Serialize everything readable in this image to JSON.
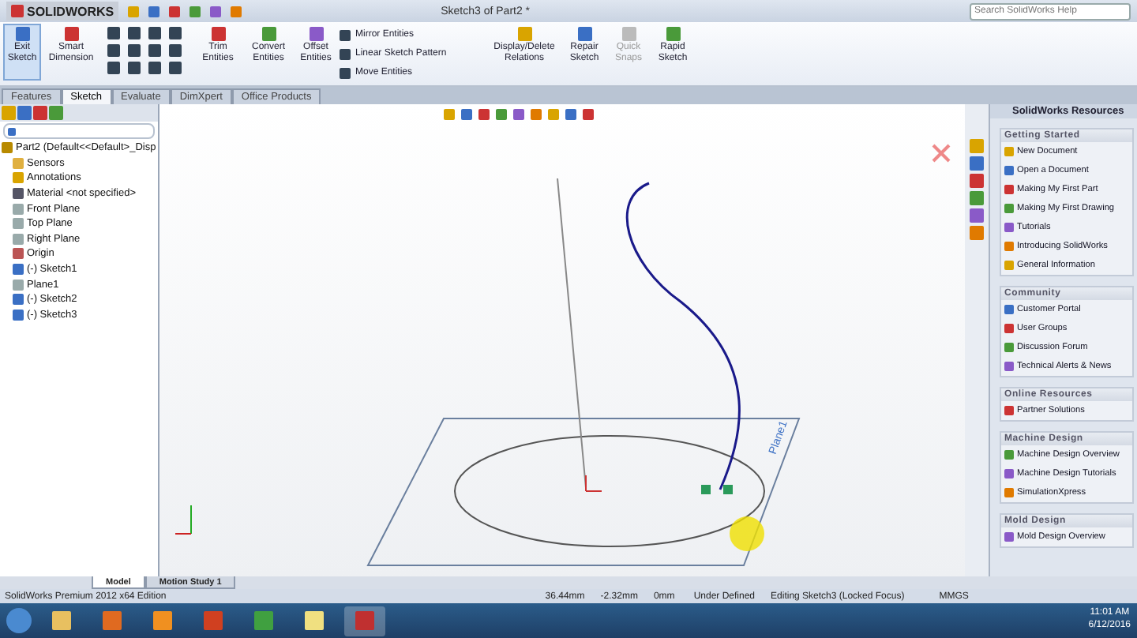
{
  "title_bar": {
    "app_name": "SOLIDWORKS",
    "document_title": "Sketch3 of Part2 *",
    "search": {
      "placeholder": "Search SolidWorks Help"
    }
  },
  "ribbon": {
    "large_buttons": [
      {
        "label": "Exit Sketch",
        "selected": true,
        "disabled": false
      },
      {
        "label": "Smart Dimension",
        "selected": false,
        "disabled": false
      },
      {
        "label": "Trim Entities",
        "selected": false,
        "disabled": false
      },
      {
        "label": "Convert Entities",
        "selected": false,
        "disabled": false
      },
      {
        "label": "Offset Entities",
        "selected": false,
        "disabled": false
      }
    ],
    "small_buttons": [
      "Mirror Entities",
      "Linear Sketch Pattern",
      "Move Entities"
    ],
    "right_buttons": [
      {
        "label": "Display/Delete Relations",
        "disabled": false
      },
      {
        "label": "Repair Sketch",
        "disabled": false
      },
      {
        "label": "Quick Snaps",
        "disabled": true
      },
      {
        "label": "Rapid Sketch",
        "disabled": false
      }
    ]
  },
  "command_tabs": [
    {
      "label": "Features",
      "selected": false
    },
    {
      "label": "Sketch",
      "selected": true
    },
    {
      "label": "Evaluate",
      "selected": false
    },
    {
      "label": "DimXpert",
      "selected": false
    },
    {
      "label": "Office Products",
      "selected": false
    }
  ],
  "feature_tree": {
    "root": "Part2  (Default<<Default>_Disp",
    "items": [
      {
        "label": "Sensors",
        "kind": "folder"
      },
      {
        "label": "Annotations",
        "kind": "annotation"
      },
      {
        "label": "Material <not specified>",
        "kind": "material"
      },
      {
        "label": "Front Plane",
        "kind": "plane"
      },
      {
        "label": "Top Plane",
        "kind": "plane"
      },
      {
        "label": "Right Plane",
        "kind": "plane"
      },
      {
        "label": "Origin",
        "kind": "origin"
      },
      {
        "label": "(-) Sketch1",
        "kind": "sketch"
      },
      {
        "label": "Plane1",
        "kind": "plane"
      },
      {
        "label": "(-) Sketch2",
        "kind": "sketch"
      },
      {
        "label": "(-) Sketch3",
        "kind": "sketch"
      }
    ]
  },
  "canvas": {
    "plane_label": "Plane1"
  },
  "task_pane": {
    "title": "SolidWorks Resources",
    "sections": [
      {
        "title": "Getting Started",
        "items": [
          "New Document",
          "Open a Document",
          "Making My First Part",
          "Making My First Drawing",
          "Tutorials",
          "Introducing SolidWorks",
          "General Information"
        ]
      },
      {
        "title": "Community",
        "items": [
          "Customer Portal",
          "User Groups",
          "Discussion Forum",
          "Technical Alerts & News"
        ]
      },
      {
        "title": "Online Resources",
        "items": [
          "Partner Solutions"
        ]
      },
      {
        "title": "Machine Design",
        "items": [
          "Machine Design Overview",
          "Machine Design Tutorials",
          "SimulationXpress"
        ]
      },
      {
        "title": "Mold Design",
        "items": [
          "Mold Design Overview"
        ]
      }
    ]
  },
  "model_tabs": [
    {
      "label": "Model",
      "selected": true
    },
    {
      "label": "Motion Study 1",
      "selected": false
    }
  ],
  "status_bar": {
    "edition": "SolidWorks Premium 2012 x64 Edition",
    "x": "36.44mm",
    "y": "-2.32mm",
    "z": "0mm",
    "state": "Under Defined",
    "mode": "Editing Sketch3 (Locked Focus)",
    "units": "MMGS"
  },
  "taskbar": {
    "time": "11:01 AM",
    "date": "6/12/2016"
  }
}
